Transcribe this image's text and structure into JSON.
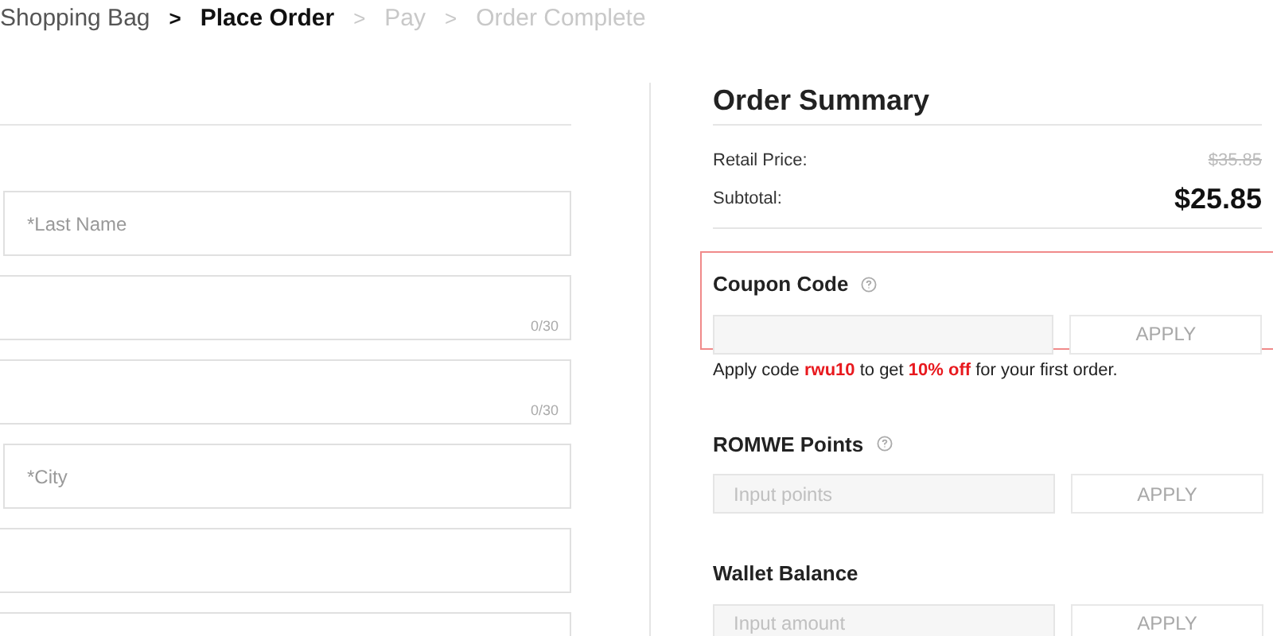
{
  "breadcrumb": [
    {
      "label": "Shopping Bag",
      "selected": false,
      "completed": true
    },
    {
      "separator": ">",
      "label": "Place Order",
      "selected": true,
      "completed": false
    },
    {
      "separator": ">",
      "label": "Pay",
      "selected": false,
      "completed": false
    },
    {
      "separator": ">",
      "label": "Order Complete",
      "selected": false,
      "completed": false
    }
  ],
  "address_fields": [
    {
      "kind": "inset",
      "placeholder": "*Last Name"
    },
    {
      "kind": "bleed",
      "counter": "0/30"
    },
    {
      "kind": "bleed",
      "counter": "0/30"
    },
    {
      "kind": "inset",
      "placeholder": "*City"
    },
    {
      "kind": "bleed"
    },
    {
      "kind": "bleed"
    }
  ],
  "summary": {
    "title": "Order Summary",
    "rows": [
      {
        "label": "Retail Price:",
        "value": "$35.85",
        "kind": "struck"
      },
      {
        "label": "Subtotal:",
        "value": "$25.85",
        "kind": "total"
      }
    ]
  },
  "coupon": {
    "title": "Coupon Code",
    "highlighted": true,
    "button": "APPLY",
    "promo": "Apply code **rwu10** to get **10% off** for your first order."
  },
  "sections": [
    {
      "title": "ROMWE Points",
      "help": true,
      "placeholder": "Input points",
      "button": "APPLY"
    },
    {
      "title": "Wallet Balance",
      "help": false,
      "placeholder": "Input amount",
      "button": "APPLY"
    }
  ]
}
